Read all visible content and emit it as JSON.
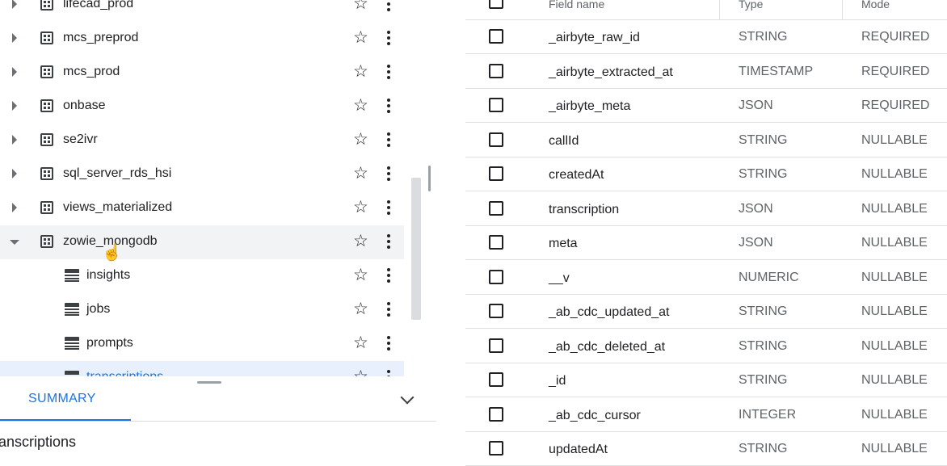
{
  "explorer": {
    "items": [
      {
        "label": "lifecad_prod",
        "kind": "dataset",
        "expanded": false
      },
      {
        "label": "mcs_preprod",
        "kind": "dataset",
        "expanded": false
      },
      {
        "label": "mcs_prod",
        "kind": "dataset",
        "expanded": false
      },
      {
        "label": "onbase",
        "kind": "dataset",
        "expanded": false
      },
      {
        "label": "se2ivr",
        "kind": "dataset",
        "expanded": false
      },
      {
        "label": "sql_server_rds_hsi",
        "kind": "dataset",
        "expanded": false
      },
      {
        "label": "views_materialized",
        "kind": "dataset",
        "expanded": false
      },
      {
        "label": "zowie_mongodb",
        "kind": "dataset",
        "expanded": true
      },
      {
        "label": "insights",
        "kind": "table"
      },
      {
        "label": "jobs",
        "kind": "table"
      },
      {
        "label": "prompts",
        "kind": "table"
      },
      {
        "label": "transcriptions",
        "kind": "table",
        "selected": true
      }
    ],
    "star_glyph": "☆"
  },
  "details": {
    "tab_label": "SUMMARY",
    "title": "ranscriptions"
  },
  "schema": {
    "headers": {
      "name": "Field name",
      "type": "Type",
      "mode": "Mode"
    },
    "fields": [
      {
        "name": "_airbyte_raw_id",
        "type": "STRING",
        "mode": "REQUIRED"
      },
      {
        "name": "_airbyte_extracted_at",
        "type": "TIMESTAMP",
        "mode": "REQUIRED"
      },
      {
        "name": "_airbyte_meta",
        "type": "JSON",
        "mode": "REQUIRED"
      },
      {
        "name": "callId",
        "type": "STRING",
        "mode": "NULLABLE"
      },
      {
        "name": "createdAt",
        "type": "STRING",
        "mode": "NULLABLE"
      },
      {
        "name": "transcription",
        "type": "JSON",
        "mode": "NULLABLE"
      },
      {
        "name": "meta",
        "type": "JSON",
        "mode": "NULLABLE"
      },
      {
        "name": "__v",
        "type": "NUMERIC",
        "mode": "NULLABLE"
      },
      {
        "name": "_ab_cdc_updated_at",
        "type": "STRING",
        "mode": "NULLABLE"
      },
      {
        "name": "_ab_cdc_deleted_at",
        "type": "STRING",
        "mode": "NULLABLE"
      },
      {
        "name": "_id",
        "type": "STRING",
        "mode": "NULLABLE"
      },
      {
        "name": "_ab_cdc_cursor",
        "type": "INTEGER",
        "mode": "NULLABLE"
      },
      {
        "name": "updatedAt",
        "type": "STRING",
        "mode": "NULLABLE"
      }
    ]
  },
  "colors": {
    "accent": "#1a73e8",
    "selected_row": "#e8f0fe"
  }
}
